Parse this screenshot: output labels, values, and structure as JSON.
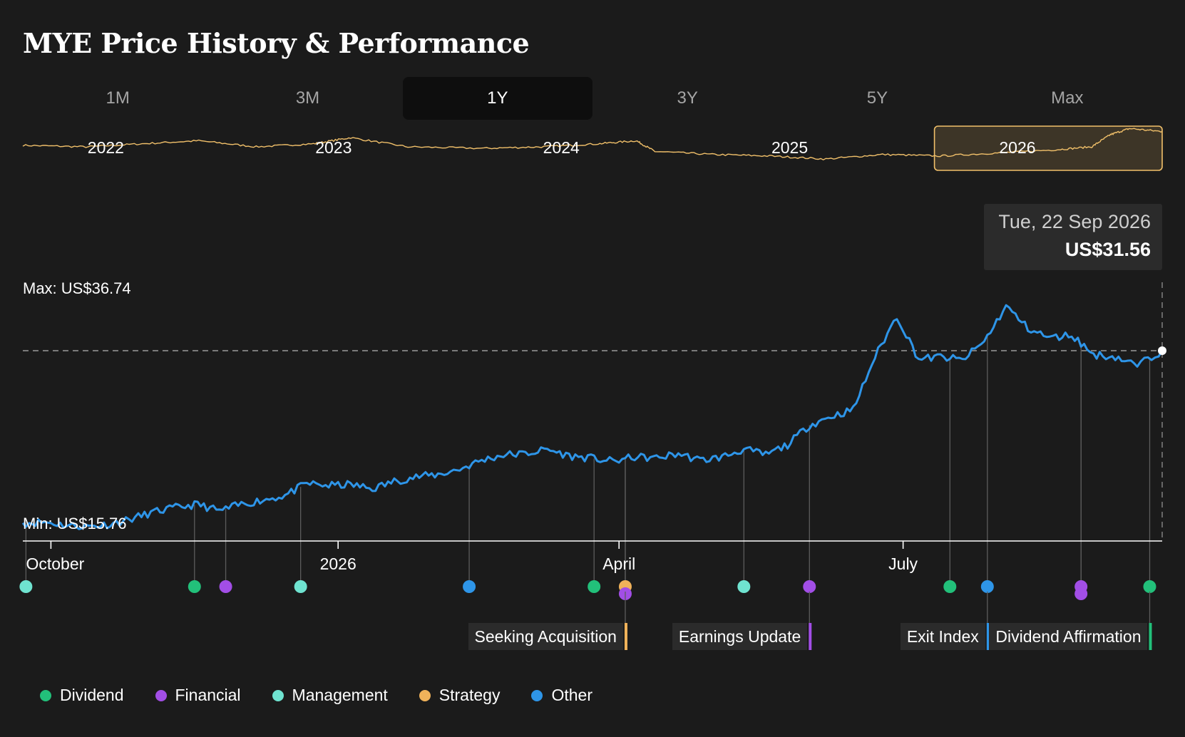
{
  "title": "MYE Price History & Performance",
  "tabs": [
    {
      "label": "1M",
      "active": false
    },
    {
      "label": "3M",
      "active": false
    },
    {
      "label": "1Y",
      "active": true
    },
    {
      "label": "3Y",
      "active": false
    },
    {
      "label": "5Y",
      "active": false
    },
    {
      "label": "Max",
      "active": false
    }
  ],
  "tooltip": {
    "date": "Tue, 22 Sep 2026",
    "price": "US$31.56"
  },
  "colors": {
    "background": "#1b1b1b",
    "price_line": "#2e95e8",
    "overview_line": "#f1c06a",
    "selection": "#f1c06a",
    "Dividend": "#22c07a",
    "Financial": "#a24ee6",
    "Management": "#6fe3d0",
    "Strategy": "#f0b25a",
    "Other": "#2e95e8"
  },
  "chart_data": {
    "type": "line",
    "title": "MYE Price History & Performance",
    "range": "1Y",
    "x_start": "2025-09-22",
    "x_end": "2026-09-22",
    "x_ticks": [
      {
        "date": "2025-10-01",
        "label": "October"
      },
      {
        "date": "2026-01-01",
        "label": "2026"
      },
      {
        "date": "2026-04-01",
        "label": "April"
      },
      {
        "date": "2026-07-01",
        "label": "July"
      }
    ],
    "ylim": [
      15.76,
      36.74
    ],
    "max_label": "Max: US$36.74",
    "min_label": "Min: US$15.76",
    "current": {
      "date": "2026-09-22",
      "value": 31.56
    },
    "series": [
      {
        "values": [
          [
            "2025-09-22",
            15.9
          ],
          [
            "2025-09-29",
            16.0
          ],
          [
            "2025-10-06",
            15.7
          ],
          [
            "2025-10-13",
            15.6
          ],
          [
            "2025-10-20",
            15.8
          ],
          [
            "2025-10-27",
            16.3
          ],
          [
            "2025-11-03",
            16.9
          ],
          [
            "2025-11-10",
            17.3
          ],
          [
            "2025-11-17",
            17.6
          ],
          [
            "2025-11-24",
            17.0
          ],
          [
            "2025-12-01",
            17.6
          ],
          [
            "2025-12-08",
            18.0
          ],
          [
            "2025-12-15",
            18.4
          ],
          [
            "2025-12-22",
            19.5
          ],
          [
            "2025-12-29",
            19.3
          ],
          [
            "2026-01-05",
            19.4
          ],
          [
            "2026-01-12",
            19.0
          ],
          [
            "2026-01-19",
            19.7
          ],
          [
            "2026-01-26",
            20.1
          ],
          [
            "2026-02-02",
            20.3
          ],
          [
            "2026-02-09",
            20.8
          ],
          [
            "2026-02-16",
            21.6
          ],
          [
            "2026-02-23",
            22.1
          ],
          [
            "2026-03-02",
            22.2
          ],
          [
            "2026-03-09",
            22.6
          ],
          [
            "2026-03-16",
            22.0
          ],
          [
            "2026-03-23",
            21.8
          ],
          [
            "2026-03-30",
            21.5
          ],
          [
            "2026-04-06",
            21.9
          ],
          [
            "2026-04-13",
            21.8
          ],
          [
            "2026-04-20",
            22.2
          ],
          [
            "2026-04-27",
            21.6
          ],
          [
            "2026-05-04",
            21.9
          ],
          [
            "2026-05-11",
            22.6
          ],
          [
            "2026-05-18",
            22.1
          ],
          [
            "2026-05-25",
            23.0
          ],
          [
            "2026-06-01",
            24.8
          ],
          [
            "2026-06-08",
            25.6
          ],
          [
            "2026-06-15",
            26.2
          ],
          [
            "2026-06-22",
            31.0
          ],
          [
            "2026-06-29",
            34.7
          ],
          [
            "2026-07-06",
            30.8
          ],
          [
            "2026-07-13",
            31.0
          ],
          [
            "2026-07-20",
            30.7
          ],
          [
            "2026-07-27",
            32.4
          ],
          [
            "2026-08-03",
            35.6
          ],
          [
            "2026-08-10",
            33.6
          ],
          [
            "2026-08-17",
            32.7
          ],
          [
            "2026-08-24",
            33.0
          ],
          [
            "2026-08-31",
            31.2
          ],
          [
            "2026-09-07",
            31.0
          ],
          [
            "2026-09-14",
            30.2
          ],
          [
            "2026-09-22",
            31.56
          ]
        ]
      }
    ],
    "overview": {
      "labels": [
        "2022",
        "2023",
        "2024",
        "2025",
        "2026"
      ],
      "selection": "1Y",
      "values": [
        [
          "2021-09-22",
          30.5
        ],
        [
          "2022-01-01",
          30.0
        ],
        [
          "2022-04-01",
          31.0
        ],
        [
          "2022-07-01",
          32.0
        ],
        [
          "2022-10-01",
          30.0
        ],
        [
          "2023-01-01",
          31.0
        ],
        [
          "2023-03-01",
          33.0
        ],
        [
          "2023-06-01",
          30.0
        ],
        [
          "2023-10-01",
          29.5
        ],
        [
          "2024-01-01",
          30.0
        ],
        [
          "2024-04-01",
          31.0
        ],
        [
          "2024-06-01",
          32.0
        ],
        [
          "2024-07-01",
          28.5
        ],
        [
          "2024-10-01",
          27.5
        ],
        [
          "2025-01-01",
          27.0
        ],
        [
          "2025-04-01",
          26.0
        ],
        [
          "2025-07-01",
          27.5
        ],
        [
          "2025-10-01",
          27.0
        ],
        [
          "2026-01-01",
          28.0
        ],
        [
          "2026-04-01",
          29.0
        ],
        [
          "2026-06-01",
          30.0
        ],
        [
          "2026-07-01",
          34.0
        ],
        [
          "2026-08-01",
          36.0
        ],
        [
          "2026-09-22",
          35.0
        ]
      ]
    },
    "events": [
      {
        "date": "2025-09-23",
        "category": "Management"
      },
      {
        "date": "2025-11-16",
        "category": "Dividend"
      },
      {
        "date": "2025-11-26",
        "category": "Financial"
      },
      {
        "date": "2025-12-20",
        "category": "Management"
      },
      {
        "date": "2026-02-12",
        "category": "Other"
      },
      {
        "date": "2026-03-24",
        "category": "Dividend"
      },
      {
        "date": "2026-04-03",
        "category": "Strategy",
        "label": "Seeking Acquisition"
      },
      {
        "date": "2026-04-03",
        "category": "Financial"
      },
      {
        "date": "2026-05-11",
        "category": "Management"
      },
      {
        "date": "2026-06-01",
        "category": "Financial",
        "label": "Earnings Update"
      },
      {
        "date": "2026-07-16",
        "category": "Dividend"
      },
      {
        "date": "2026-07-28",
        "category": "Other",
        "label": "Exit Index"
      },
      {
        "date": "2026-08-27",
        "category": "Financial"
      },
      {
        "date": "2026-08-27",
        "category": "Financial"
      },
      {
        "date": "2026-09-18",
        "category": "Dividend",
        "label": "Dividend Affirmation"
      }
    ]
  },
  "legend": [
    {
      "label": "Dividend",
      "color": "#22c07a"
    },
    {
      "label": "Financial",
      "color": "#a24ee6"
    },
    {
      "label": "Management",
      "color": "#6fe3d0"
    },
    {
      "label": "Strategy",
      "color": "#f0b25a"
    },
    {
      "label": "Other",
      "color": "#2e95e8"
    }
  ]
}
